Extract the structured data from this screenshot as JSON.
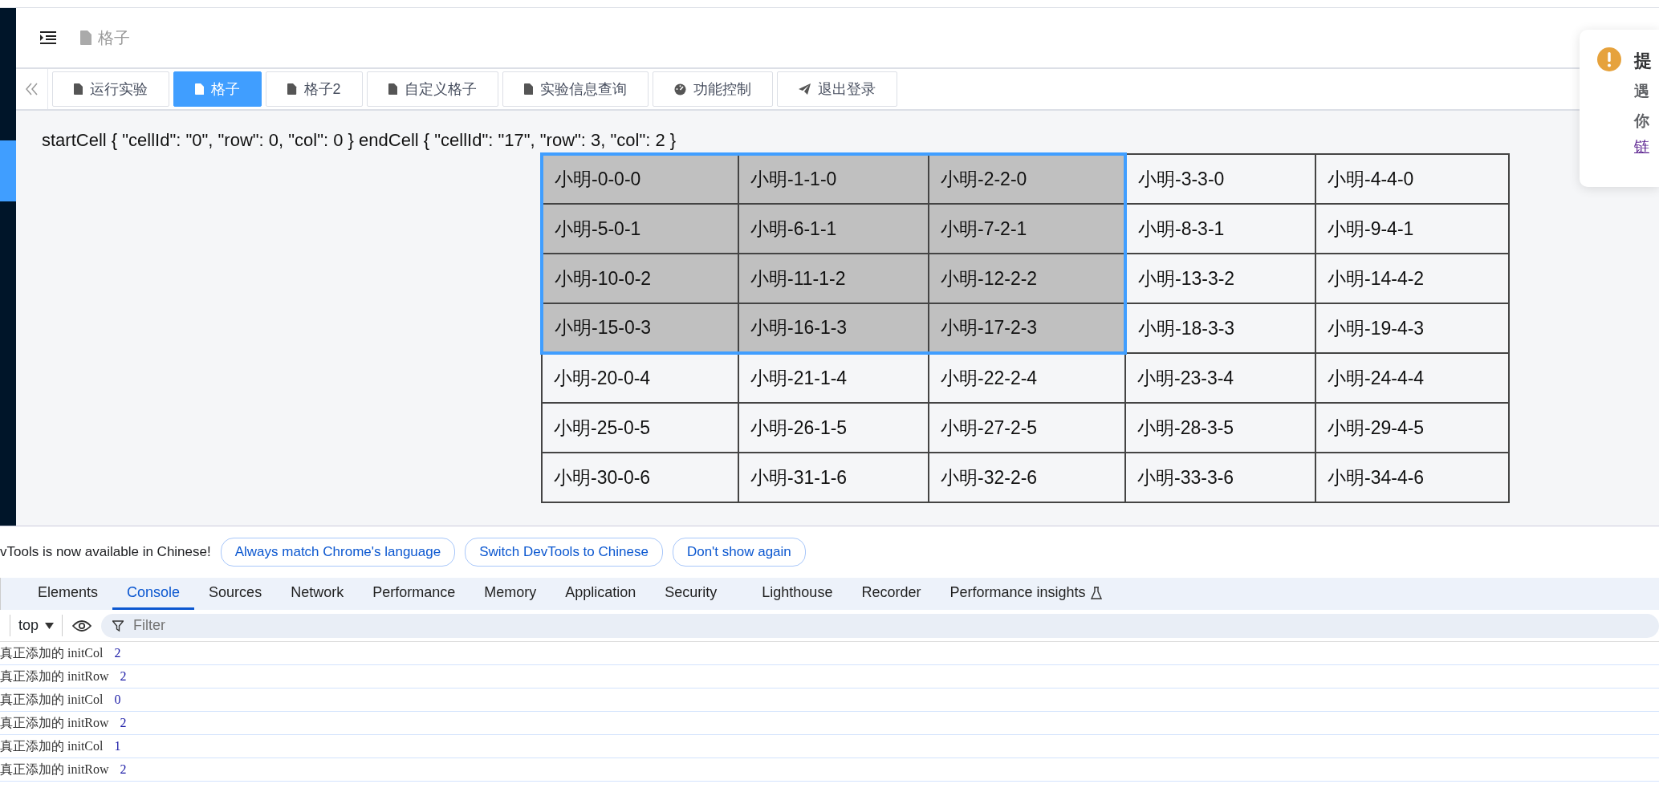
{
  "header": {
    "breadcrumb": "格子"
  },
  "tabs": [
    {
      "label": "运行实验",
      "kind": "page",
      "selected": false
    },
    {
      "label": "格子",
      "kind": "page",
      "selected": true
    },
    {
      "label": "格子2",
      "kind": "page",
      "selected": false
    },
    {
      "label": "自定义格子",
      "kind": "page",
      "selected": false
    },
    {
      "label": "实验信息查询",
      "kind": "page",
      "selected": false
    },
    {
      "label": "功能控制",
      "kind": "gauge",
      "selected": false
    },
    {
      "label": "退出登录",
      "kind": "send",
      "selected": false
    }
  ],
  "selection_text": "startCell { \"cellId\": \"0\", \"row\": 0, \"col\": 0 } endCell { \"cellId\": \"17\", \"row\": 3, \"col\": 2 }",
  "grid": {
    "rows": [
      [
        {
          "text": "小明-0-0-0",
          "selected": true
        },
        {
          "text": "小明-1-1-0",
          "selected": true
        },
        {
          "text": "小明-2-2-0",
          "selected": true
        },
        {
          "text": "小明-3-3-0",
          "selected": false
        },
        {
          "text": "小明-4-4-0",
          "selected": false
        }
      ],
      [
        {
          "text": "小明-5-0-1",
          "selected": true
        },
        {
          "text": "小明-6-1-1",
          "selected": true
        },
        {
          "text": "小明-7-2-1",
          "selected": true
        },
        {
          "text": "小明-8-3-1",
          "selected": false
        },
        {
          "text": "小明-9-4-1",
          "selected": false
        }
      ],
      [
        {
          "text": "小明-10-0-2",
          "selected": true
        },
        {
          "text": "小明-11-1-2",
          "selected": true
        },
        {
          "text": "小明-12-2-2",
          "selected": true
        },
        {
          "text": "小明-13-3-2",
          "selected": false
        },
        {
          "text": "小明-14-4-2",
          "selected": false
        }
      ],
      [
        {
          "text": "小明-15-0-3",
          "selected": true
        },
        {
          "text": "小明-16-1-3",
          "selected": true
        },
        {
          "text": "小明-17-2-3",
          "selected": true
        },
        {
          "text": "小明-18-3-3",
          "selected": false
        },
        {
          "text": "小明-19-4-3",
          "selected": false
        }
      ],
      [
        {
          "text": "小明-20-0-4",
          "selected": false
        },
        {
          "text": "小明-21-1-4",
          "selected": false
        },
        {
          "text": "小明-22-2-4",
          "selected": false
        },
        {
          "text": "小明-23-3-4",
          "selected": false
        },
        {
          "text": "小明-24-4-4",
          "selected": false
        }
      ],
      [
        {
          "text": "小明-25-0-5",
          "selected": false
        },
        {
          "text": "小明-26-1-5",
          "selected": false
        },
        {
          "text": "小明-27-2-5",
          "selected": false
        },
        {
          "text": "小明-28-3-5",
          "selected": false
        },
        {
          "text": "小明-29-4-5",
          "selected": false
        }
      ],
      [
        {
          "text": "小明-30-0-6",
          "selected": false
        },
        {
          "text": "小明-31-1-6",
          "selected": false
        },
        {
          "text": "小明-32-2-6",
          "selected": false
        },
        {
          "text": "小明-33-3-6",
          "selected": false
        },
        {
          "text": "小明-34-4-6",
          "selected": false
        }
      ]
    ]
  },
  "notification": {
    "title": "提",
    "lines": [
      "遇",
      "你"
    ],
    "link": "链"
  },
  "devtools": {
    "infobar": {
      "message": "vTools is now available in Chinese!",
      "buttons": [
        "Always match Chrome's language",
        "Switch DevTools to Chinese",
        "Don't show again"
      ]
    },
    "tabs": [
      {
        "label": "Elements",
        "selected": false
      },
      {
        "label": "Console",
        "selected": true
      },
      {
        "label": "Sources",
        "selected": false
      },
      {
        "label": "Network",
        "selected": false
      },
      {
        "label": "Performance",
        "selected": false
      },
      {
        "label": "Memory",
        "selected": false
      },
      {
        "label": "Application",
        "selected": false
      },
      {
        "label": "Security",
        "selected": false
      },
      {
        "label": "Lighthouse",
        "selected": false
      },
      {
        "label": "Recorder",
        "selected": false
      },
      {
        "label": "Performance insights",
        "selected": false
      }
    ],
    "context": "top",
    "filter_placeholder": "Filter",
    "console": [
      {
        "message": "真正添加的 initCol",
        "value": "2"
      },
      {
        "message": "真正添加的 initRow",
        "value": "2"
      },
      {
        "message": "真正添加的 initCol",
        "value": "0"
      },
      {
        "message": "真正添加的 initRow",
        "value": "2"
      },
      {
        "message": "真正添加的 initCol",
        "value": "1"
      },
      {
        "message": "真正添加的 initRow",
        "value": "2"
      }
    ]
  }
}
